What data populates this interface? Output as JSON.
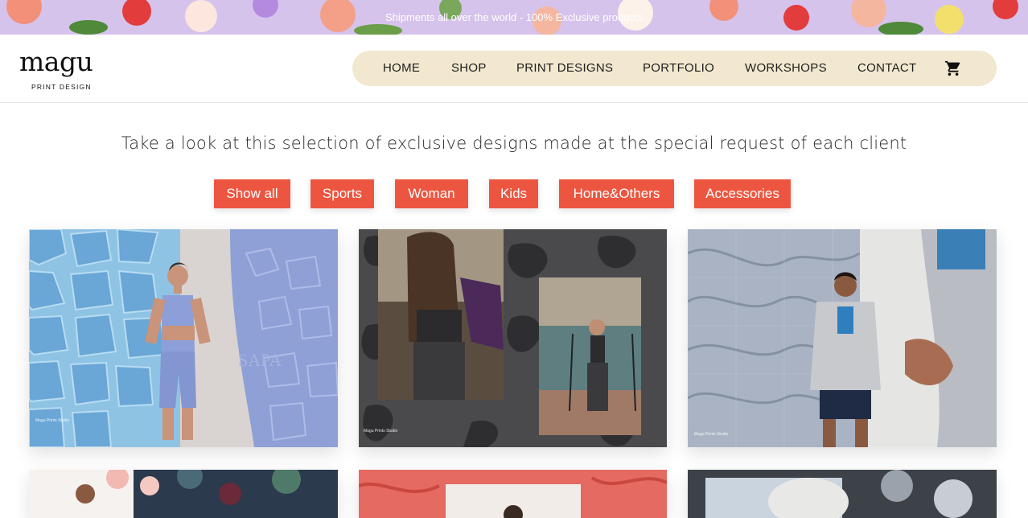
{
  "banner": {
    "text": "Shipments all over the world - 100% Exclusive products"
  },
  "logo": {
    "name": "magu",
    "subtitle": "PRINT DESIGN"
  },
  "nav": {
    "items": [
      "HOME",
      "SHOP",
      "PRINT DESIGNS",
      "PORTFOLIO",
      "WORKSHOPS",
      "CONTACT"
    ],
    "cart_icon": "shopping-cart-icon"
  },
  "main": {
    "headline": "Take a look at this selection of exclusive designs made at the special request of each client",
    "filters": [
      "Show all",
      "Sports",
      "Woman",
      "Kids",
      "Home&Others",
      "Accessories"
    ]
  },
  "portfolio": {
    "cards": [
      {
        "caption_brand": "Magu Prints Studio",
        "logo_text": "SAPA"
      },
      {
        "caption_brand": "Magu Prints Studio"
      },
      {
        "caption_brand": "Magu Prints Studio"
      }
    ]
  },
  "colors": {
    "accent": "#ec5640",
    "nav_bg": "#f1e8cf",
    "text": "#222222"
  }
}
